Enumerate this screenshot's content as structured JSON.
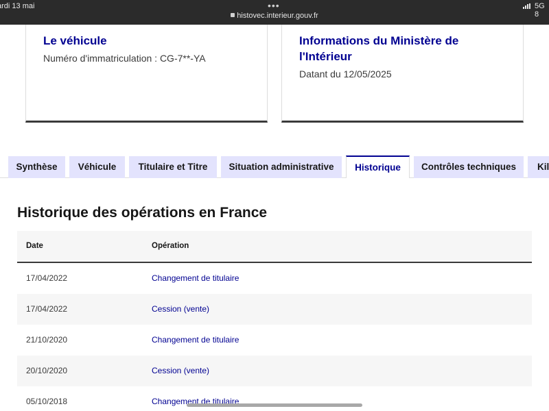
{
  "status_bar": {
    "time": "ardi 13 mai",
    "dots": "•••",
    "url": "histovec.interieur.gouv.fr",
    "network": "5G 8"
  },
  "cards": [
    {
      "title": "Le véhicule",
      "subtitle": "Numéro d'immatriculation : CG-7**-YA"
    },
    {
      "title": "Informations du Ministère de l'Intérieur",
      "subtitle": "Datant du 12/05/2025"
    }
  ],
  "tabs": [
    {
      "label": "Synthèse",
      "active": false
    },
    {
      "label": "Véhicule",
      "active": false
    },
    {
      "label": "Titulaire et Titre",
      "active": false
    },
    {
      "label": "Situation administrative",
      "active": false
    },
    {
      "label": "Historique",
      "active": true
    },
    {
      "label": "Contrôles techniques",
      "active": false
    },
    {
      "label": "Kilo",
      "active": false
    }
  ],
  "section": {
    "title": "Historique des opérations en France"
  },
  "table": {
    "columns": [
      "Date",
      "Opération"
    ],
    "rows": [
      {
        "date": "17/04/2022",
        "operation": "Changement de titulaire"
      },
      {
        "date": "17/04/2022",
        "operation": "Cession (vente)"
      },
      {
        "date": "21/10/2020",
        "operation": "Changement de titulaire"
      },
      {
        "date": "20/10/2020",
        "operation": "Cession (vente)"
      },
      {
        "date": "05/10/2018",
        "operation": "Changement de titulaire"
      }
    ]
  },
  "colors": {
    "accent": "#000091",
    "tab_bg": "#e3e3fd",
    "row_alt": "#f6f6f6"
  }
}
